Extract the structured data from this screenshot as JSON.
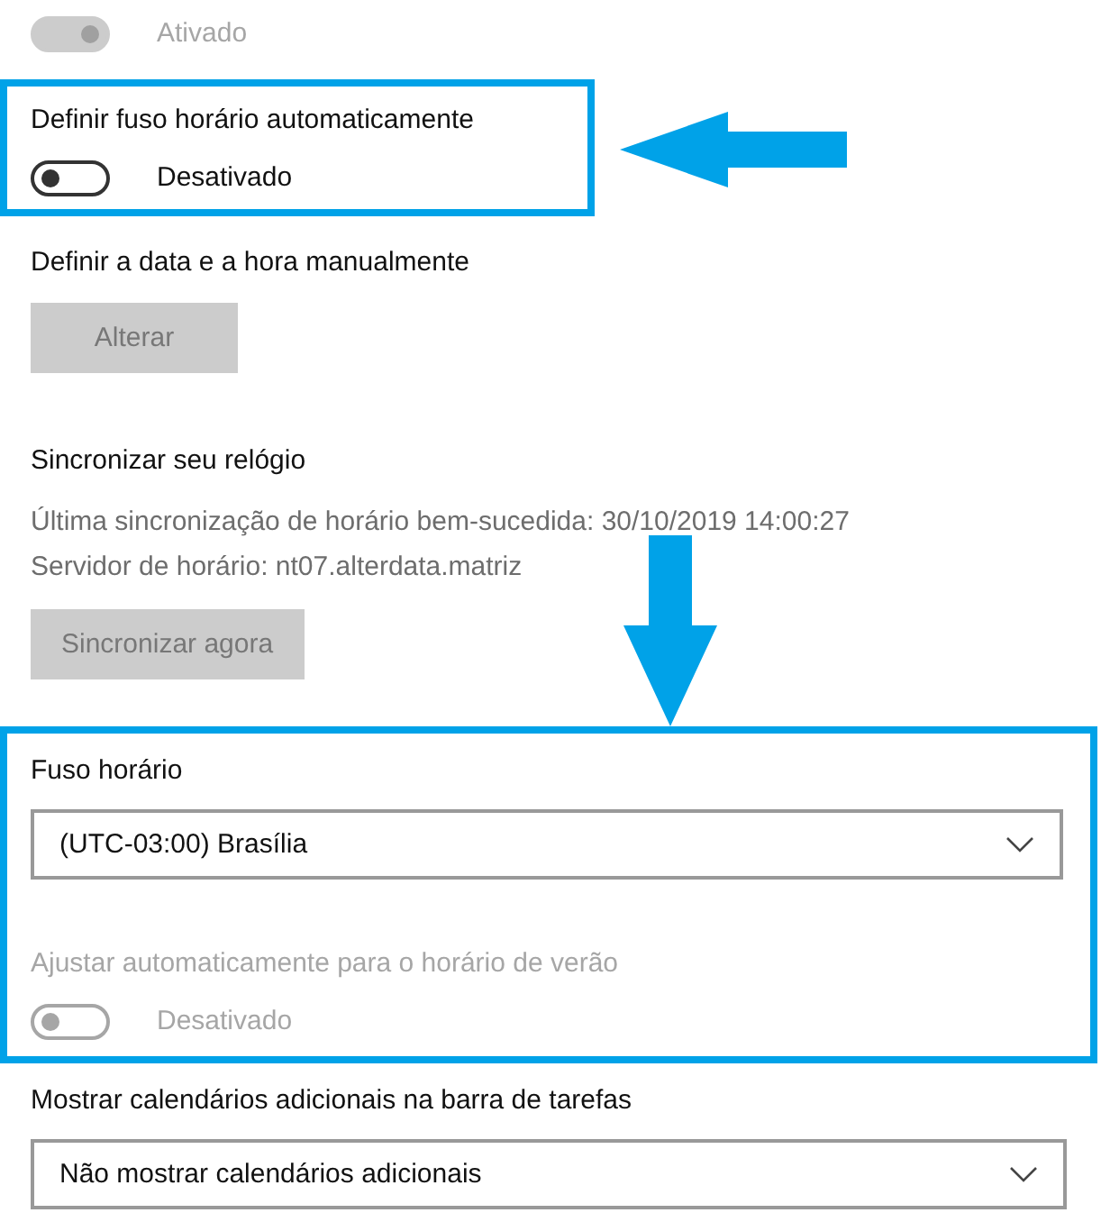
{
  "groups": [
    {
      "highlighted": false,
      "items": [
        {
          "kind": "toggle",
          "on": true,
          "disabled": true,
          "state_label": "Ativado"
        }
      ]
    },
    {
      "highlighted": true,
      "callout": {
        "kind": "arrow_left"
      },
      "items": [
        {
          "kind": "toggle",
          "title": "Definir fuso horário automaticamente",
          "on": false,
          "disabled": false,
          "state_label": "Desativado"
        }
      ]
    },
    {
      "highlighted": false,
      "items": [
        {
          "kind": "button",
          "title": "Definir a data e a hora manualmente",
          "button": "Alterar",
          "disabled": true
        },
        {
          "kind": "button",
          "title": "Sincronizar seu relógio",
          "lines": [
            "Última sincronização de horário bem-sucedida: 30/10/2019 14:00:27",
            "Servidor de horário: nt07.alterdata.matriz"
          ],
          "button": "Sincronizar agora",
          "disabled": true
        }
      ]
    },
    {
      "highlighted": true,
      "callout": {
        "kind": "arrow_down"
      },
      "items": [
        {
          "kind": "dropdown",
          "title": "Fuso horário",
          "value": "(UTC-03:00) Brasília"
        },
        {
          "kind": "toggle",
          "title": "Ajustar automaticamente para o horário de verão",
          "on": false,
          "disabled": true,
          "state_label": "Desativado"
        }
      ]
    },
    {
      "highlighted": false,
      "items": [
        {
          "kind": "dropdown",
          "title": "Mostrar calendários adicionais na barra de tarefas",
          "value": "Não mostrar calendários adicionais"
        }
      ]
    }
  ]
}
